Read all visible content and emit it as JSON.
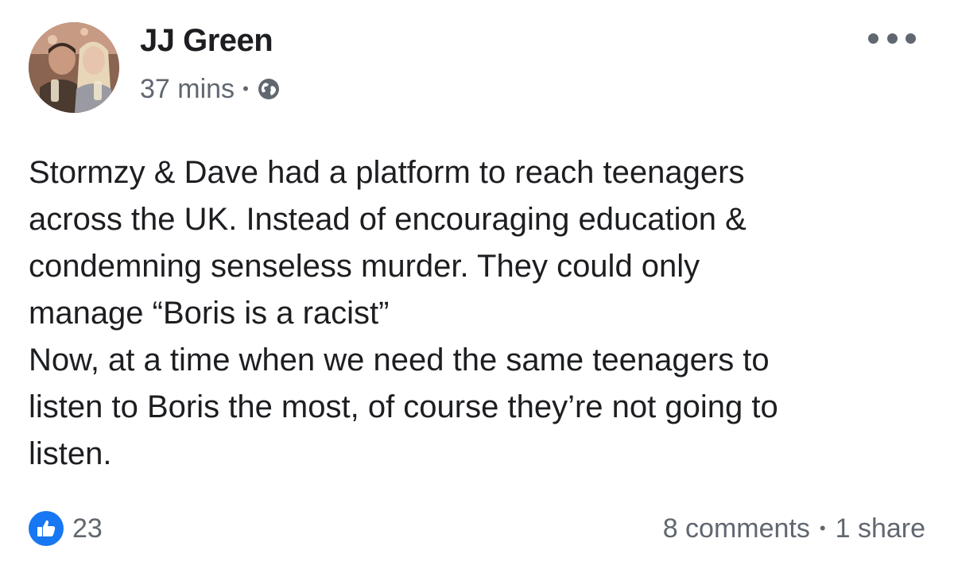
{
  "post": {
    "author": "JJ Green",
    "timestamp": "37 mins",
    "separator": "•",
    "privacy_icon": "globe-icon",
    "body_lines": [
      "Stormzy & Dave had a platform to reach teenagers",
      "across the UK.  Instead of encouraging education &",
      "condemning senseless murder.  They could only",
      "manage “Boris is a racist”",
      "Now, at a time when we need the same teenagers to",
      "listen to Boris the most, of course they’re not going to",
      "listen."
    ]
  },
  "engagement": {
    "like_count": "23",
    "comments": "8 comments",
    "separator": "•",
    "shares": "1 share"
  },
  "colors": {
    "text": "#1c1e21",
    "secondary": "#606770",
    "like_blue": "#1877f2"
  }
}
